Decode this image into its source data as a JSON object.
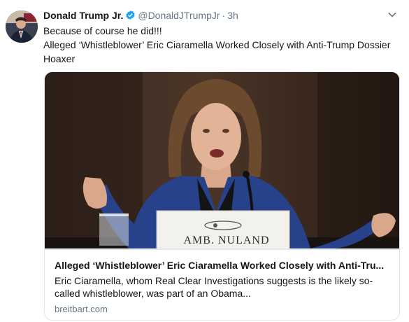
{
  "tweet": {
    "author_name": "Donald Trump Jr.",
    "handle": "@DonaldJTrumpJr",
    "separator": "·",
    "time": "3h",
    "icons": {
      "verified": "verified-badge-icon",
      "menu": "chevron-down-icon"
    },
    "text_lines": [
      "Because of course he did!!!",
      "Alleged ‘Whistleblower’ Eric Ciaramella Worked Closely with Anti-Trump Dossier Hoaxer"
    ]
  },
  "card": {
    "image_plate_text": "AMB. NULAND",
    "title": "Alleged ‘Whistleblower’ Eric Ciaramella Worked Closely with Anti-Tru...",
    "description": "Eric Ciaramella, whom Real Clear Investigations suggests is the likely so-called whistleblower, was part of an Obama...",
    "domain": "breitbart.com"
  },
  "colors": {
    "verified": "#1da1f2",
    "secondary_text": "#657786",
    "border": "#e1e8ed"
  }
}
